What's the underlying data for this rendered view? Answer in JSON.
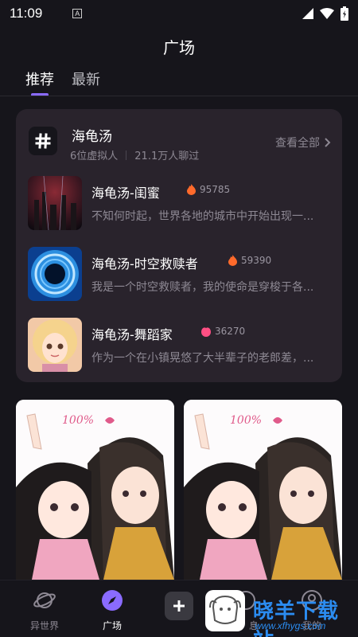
{
  "status_bar": {
    "time": "11:09",
    "notification_letter": "A"
  },
  "header": {
    "title": "广场"
  },
  "tabs": [
    {
      "label": "推荐",
      "active": true
    },
    {
      "label": "最新",
      "active": false
    }
  ],
  "topic_card": {
    "title": "海龟汤",
    "virtual_count": "6位虚拟人",
    "chat_count": "21.1万人聊过",
    "see_all": "查看全部",
    "items": [
      {
        "name": "海龟汤-闺蜜",
        "heat": "95785",
        "desc": "不知何时起，世界各地的城市中开始出现一..."
      },
      {
        "name": "海龟汤-时空救赎者",
        "heat": "59390",
        "desc": "我是一个时空救赎者，我的使命是穿梭于各..."
      },
      {
        "name": "海龟汤-舞蹈家",
        "heat": "36270",
        "desc": "作为一个在小镇晃悠了大半辈子的老郎差，..."
      }
    ]
  },
  "art_text": "100%",
  "bottom_nav": {
    "items": [
      {
        "label": "异世界",
        "icon": "planet-icon"
      },
      {
        "label": "广场",
        "icon": "compass-icon"
      },
      {
        "label": "息",
        "icon": "message-icon"
      },
      {
        "label": "我的",
        "icon": "profile-icon"
      }
    ]
  },
  "watermark": {
    "text": "晓羊下载站",
    "url": "www.xfhygs.com"
  },
  "colors": {
    "accent": "#8a6bff",
    "background": "#16151b",
    "card": "#29232c",
    "flame": "#ff6a2b",
    "watermark": "#2b8cf0"
  }
}
